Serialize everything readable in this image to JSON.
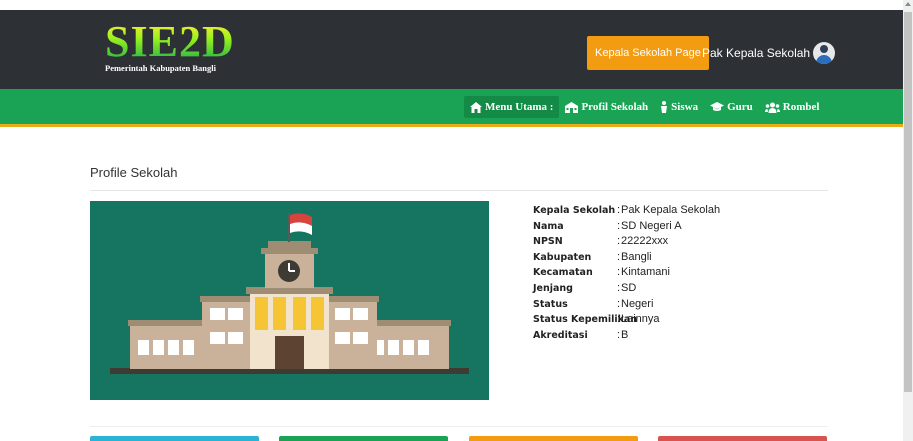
{
  "header": {
    "logo_title": "SIE2D",
    "logo_subtitle": "Pemerintah Kabupaten Bangli",
    "kepala_button": "Kepala Sekolah Page",
    "user_name": "Pak Kepala Sekolah"
  },
  "nav": {
    "items": [
      {
        "label": "Menu Utama :",
        "icon": "home-icon"
      },
      {
        "label": "Profil Sekolah",
        "icon": "school-icon"
      },
      {
        "label": "Siswa",
        "icon": "student-icon"
      },
      {
        "label": "Guru",
        "icon": "graduation-cap-icon"
      },
      {
        "label": "Rombel",
        "icon": "users-icon"
      }
    ]
  },
  "page": {
    "title": "Profile Sekolah"
  },
  "profile": {
    "rows": [
      {
        "label": "Kepala Sekolah",
        "value": "Pak Kepala Sekolah"
      },
      {
        "label": "Nama",
        "value": "SD Negeri A"
      },
      {
        "label": "NPSN",
        "value": "22222xxx"
      },
      {
        "label": "Kabupaten",
        "value": "Bangli"
      },
      {
        "label": "Kecamatan",
        "value": "Kintamani"
      },
      {
        "label": "Jenjang",
        "value": "SD"
      },
      {
        "label": "Status",
        "value": "Negeri"
      },
      {
        "label": "Status Kepemilikan",
        "value": "Lainnya"
      },
      {
        "label": "Akreditasi",
        "value": "B"
      }
    ]
  },
  "colors": {
    "header_bg": "#2d3136",
    "nav_bg": "#1aa355",
    "nav_border": "#e8ad16",
    "button_orange": "#f39c12",
    "image_bg": "#157560",
    "card_colors": [
      "#2bb3d6",
      "#1aa355",
      "#f39c12",
      "#d9534f"
    ]
  }
}
